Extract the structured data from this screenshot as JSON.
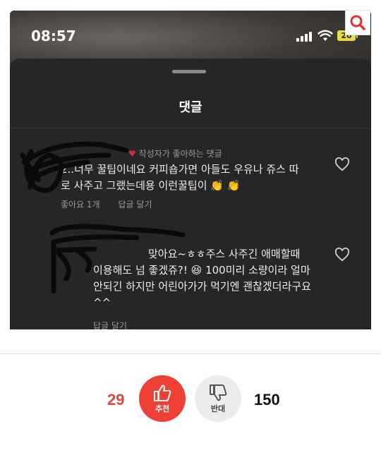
{
  "screenshot": {
    "status": {
      "time": "08:57",
      "battery": "20"
    },
    "sheet": {
      "title": "댓글",
      "comments": [
        {
          "author_tag": "작성자가 좋아하는 댓글",
          "text_line1": "2..너무 꿀팁이네요 커피숍가면 아들도 우유나 쥬스 따",
          "text_line2": "로 사주고 그랬는데용 이런꿀팁이 👏 👏",
          "likes": "좋아요 1개",
          "reply": "답글 달기"
        },
        {
          "text_line1": "맞아요~ㅎㅎ주스 사주긴 애매할때",
          "text_line2": "이용해도 넘 좋겠쥬?! 😆 100미리 소량이라 얼마",
          "text_line3": "안되긴 하지만 어린아가가 먹기엔 괜찮겠더라구요",
          "text_line4": "^^",
          "reply": "답글 달기"
        }
      ]
    }
  },
  "votes": {
    "up_count": "29",
    "up_label": "추천",
    "down_label": "반대",
    "down_count": "150"
  },
  "colors": {
    "accent": "#ee4035",
    "sheet": "#262626"
  },
  "icons": [
    "search-icon",
    "heart-icon",
    "thumbs-up-icon",
    "thumbs-down-icon",
    "wifi-icon",
    "signal-icon",
    "battery-icon"
  ]
}
